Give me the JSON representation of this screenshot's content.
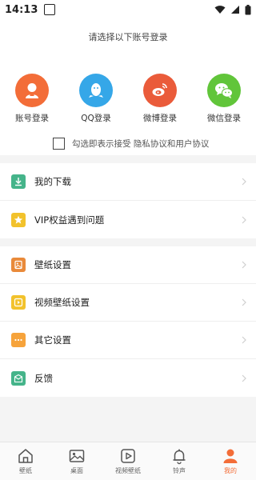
{
  "status_bar": {
    "time": "14:13"
  },
  "login": {
    "title": "请选择以下账号登录",
    "options": [
      {
        "label": "账号登录",
        "color": "#f36d38",
        "icon": "account-icon"
      },
      {
        "label": "QQ登录",
        "color": "#35a7e8",
        "icon": "qq-icon"
      },
      {
        "label": "微博登录",
        "color": "#ea5b3a",
        "icon": "weibo-icon"
      },
      {
        "label": "微信登录",
        "color": "#61c53a",
        "icon": "wechat-icon"
      }
    ],
    "agreement": "勾选即表示接受 隐私协议和用户协议"
  },
  "menu": {
    "group1": [
      {
        "label": "我的下载",
        "color": "#45b48a",
        "icon": "download-icon"
      },
      {
        "label": "VIP权益遇到问题",
        "color": "#f2c22c",
        "icon": "star-icon"
      }
    ],
    "group2": [
      {
        "label": "壁纸设置",
        "color": "#e98a3a",
        "icon": "wallpaper-icon"
      },
      {
        "label": "视频壁纸设置",
        "color": "#f2c22c",
        "icon": "video-icon"
      },
      {
        "label": "其它设置",
        "color": "#f6a33b",
        "icon": "more-icon"
      },
      {
        "label": "反馈",
        "color": "#45b48a",
        "icon": "feedback-icon"
      }
    ]
  },
  "tabs": [
    {
      "label": "壁纸",
      "icon": "home-icon"
    },
    {
      "label": "桌面",
      "icon": "image-icon"
    },
    {
      "label": "视频壁纸",
      "icon": "play-icon"
    },
    {
      "label": "铃声",
      "icon": "bell-icon"
    },
    {
      "label": "我的",
      "icon": "profile-icon",
      "active": true
    }
  ],
  "colors": {
    "accent": "#f36d38"
  }
}
